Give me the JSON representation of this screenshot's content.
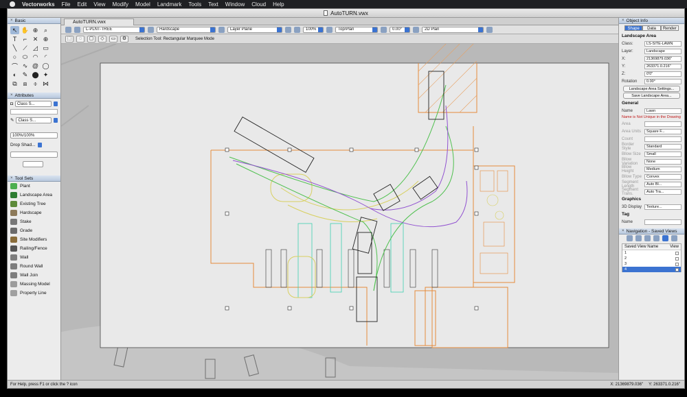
{
  "menubar": {
    "app": "Vectorworks",
    "items": [
      "File",
      "Edit",
      "View",
      "Modify",
      "Model",
      "Landmark",
      "Tools",
      "Text",
      "Window",
      "Cloud",
      "Help"
    ]
  },
  "window": {
    "title": "AutoTURN.vwx",
    "tab": "AutoTURN.vwx"
  },
  "palettes": {
    "basic": "Basic",
    "attributes": "Attributes",
    "class_fill": "Class S...",
    "class_pen": "Class S...",
    "opacity": "100%/100%",
    "drop_shadow": "Drop Shad...",
    "tool_sets": "Tool Sets"
  },
  "toolsets": [
    {
      "label": "Plant",
      "color": "#4caf50"
    },
    {
      "label": "Landscape Area",
      "color": "#2e7d32"
    },
    {
      "label": "Existing Tree",
      "color": "#5d8a3a"
    },
    {
      "label": "Hardscape",
      "color": "#8d7a5a"
    },
    {
      "label": "Stake",
      "color": "#777777"
    },
    {
      "label": "Grade",
      "color": "#6b6b6b"
    },
    {
      "label": "Site Modifiers",
      "color": "#8a6d3b"
    },
    {
      "label": "Railing/Fence",
      "color": "#555555"
    },
    {
      "label": "Wall",
      "color": "#7d7d7d"
    },
    {
      "label": "Round Wall",
      "color": "#7d7d7d"
    },
    {
      "label": "Wall Join",
      "color": "#7d7d7d"
    },
    {
      "label": "Massing Model",
      "color": "#9c9c9c"
    },
    {
      "label": "Property Line",
      "color": "#a0a0a0"
    }
  ],
  "viewbar": {
    "class": "L-PLNT-TREE",
    "layer": "Hardscape",
    "plane": "Layer Plane",
    "zoom": "100%",
    "render": "Top/Plan",
    "angle": "0.00°",
    "view": "2D Plan"
  },
  "modebar": {
    "hint": "Selection Tool: Rectangular Marquee Mode"
  },
  "object_info": {
    "title": "Object Info",
    "tabs": [
      "Shape",
      "Data",
      "Render"
    ],
    "object_type": "Landscape Area",
    "class": "LS-SITE-LAWN",
    "layer": "Landscape",
    "x": "21369879.036\"",
    "y": "263371.0.216\"",
    "z": "0'0\"",
    "rotation": "0.00°",
    "btn_settings": "Landscape Area Settings...",
    "btn_save": "Save Landscape Area...",
    "general": "General",
    "name_label": "Name",
    "name_val": "Lawn",
    "warning": "Name is Not Unique in the Drawing",
    "rows": [
      {
        "label": "Area",
        "val": ""
      },
      {
        "label": "Area Units",
        "val": "Square F..."
      },
      {
        "label": "Count",
        "val": ""
      },
      {
        "label": "Border Style",
        "val": "Standard"
      },
      {
        "label": "Bllow Size",
        "val": "Small"
      },
      {
        "label": "Bllow Variation",
        "val": "None"
      },
      {
        "label": "Bllow Height",
        "val": "Medium"
      },
      {
        "label": "Bllow Type",
        "val": "Convex"
      },
      {
        "label": "Segment Length",
        "val": "Auto Bl..."
      },
      {
        "label": "Segment Trans.",
        "val": "Auto Tra..."
      }
    ],
    "graphics": "Graphics",
    "display_label": "3D Display",
    "display_val": "Texture...",
    "tag": "Tag",
    "tag_name": "Name"
  },
  "navigation": {
    "title": "Navigation - Saved Views",
    "col_name": "Saved View Name",
    "col_view": "View",
    "rows": [
      "1",
      "2",
      "3",
      "4"
    ]
  },
  "status": {
    "hint": "For Help, press F1 or click the ? icon",
    "x": "X: 21369879.036\"",
    "y": "Y: 263371.0.216\""
  }
}
